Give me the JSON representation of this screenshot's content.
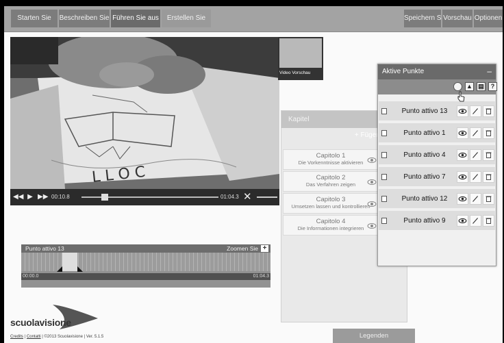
{
  "toolbar": {
    "tabs": [
      {
        "label": "Starten Sie"
      },
      {
        "label": "Beschreiben Sie"
      },
      {
        "label": "Führen Sie aus"
      },
      {
        "label": "Erstellen Sie"
      }
    ],
    "right": [
      {
        "label": "Speichern Sie"
      },
      {
        "label": "Vorschau"
      },
      {
        "label": "Optionen"
      }
    ]
  },
  "player": {
    "current_time": "00:10.8",
    "duration": "01:04.3",
    "progress": 0.17
  },
  "preview": {
    "label": "Video Vorschau"
  },
  "kapitel": {
    "title": "Kapitel",
    "add_label": "+ Fügen Sie an",
    "items": [
      {
        "title": "Capitolo 1",
        "subtitle": "Die Vorkenntnisse aktivieren"
      },
      {
        "title": "Capitolo 2",
        "subtitle": "Das Verfahren zeigen"
      },
      {
        "title": "Capitolo 3",
        "subtitle": "Umsetzen lassen und kontrollieren"
      },
      {
        "title": "Capitolo 4",
        "subtitle": "Die Informationen integrieren"
      }
    ]
  },
  "timeline": {
    "label": "Punto attivo 13",
    "zoom_label": "Zoomen Sie",
    "zoom_plus": "+",
    "start_time": "00:00.0",
    "end_time": "01:04.3"
  },
  "aktive_punkte": {
    "title": "Aktive Punkte",
    "minimize": "–",
    "help_label": "?",
    "items": [
      {
        "label": "Punto attivo 13"
      },
      {
        "label": "Punto attivo 1"
      },
      {
        "label": "Punto attivo 4"
      },
      {
        "label": "Punto attivo 7"
      },
      {
        "label": "Punto attivo 12"
      },
      {
        "label": "Punto attivo 9"
      }
    ]
  },
  "logo": {
    "text": "scuolavisione"
  },
  "footer": {
    "credits": "Credits",
    "sep1": "|",
    "contacts": "Contatti",
    "copyright": "| ©2013 Scuolavisione | Ver. 5.1.5"
  },
  "legend_button": {
    "label": "Legenden"
  },
  "colors": {
    "toolbar_bg": "#a3a3a3",
    "active_tab": "#6b6b6b",
    "panel_header": "#6a6a6a"
  }
}
